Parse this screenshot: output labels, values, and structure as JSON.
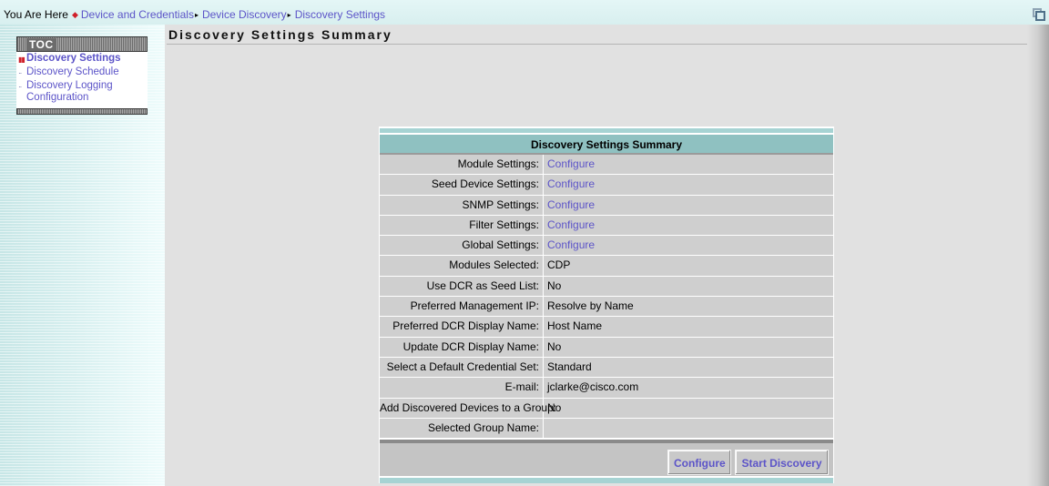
{
  "breadcrumb": {
    "prefix": "You Are Here",
    "items": [
      {
        "label": "Device and Credentials"
      },
      {
        "label": "Device Discovery"
      },
      {
        "label": "Discovery Settings"
      }
    ]
  },
  "page": {
    "title": "Discovery Settings Summary"
  },
  "toc": {
    "header": "TOC",
    "items": [
      {
        "label": "Discovery Settings",
        "active": true
      },
      {
        "label": "Discovery Schedule",
        "active": false
      },
      {
        "label": "Discovery Logging Configuration",
        "active": false
      }
    ]
  },
  "summary": {
    "title": "Discovery Settings Summary",
    "rows": [
      {
        "label": "Module Settings:",
        "value": "Configure",
        "link": true
      },
      {
        "label": "Seed Device Settings:",
        "value": "Configure",
        "link": true
      },
      {
        "label": "SNMP Settings:",
        "value": "Configure",
        "link": true
      },
      {
        "label": "Filter Settings:",
        "value": "Configure",
        "link": true
      },
      {
        "label": "Global Settings:",
        "value": "Configure",
        "link": true
      },
      {
        "label": "Modules Selected:",
        "value": "CDP",
        "link": false
      },
      {
        "label": "Use DCR as Seed List:",
        "value": "No",
        "link": false
      },
      {
        "label": "Preferred Management IP:",
        "value": "Resolve by Name",
        "link": false
      },
      {
        "label": "Preferred DCR Display Name:",
        "value": "Host Name",
        "link": false
      },
      {
        "label": "Update DCR Display Name:",
        "value": "No",
        "link": false
      },
      {
        "label": "Select a Default Credential Set:",
        "value": "Standard",
        "link": false
      },
      {
        "label": "E-mail:",
        "value": "jclarke@cisco.com",
        "link": false
      },
      {
        "label": "Add Discovered Devices to a Group:",
        "value": "No",
        "link": false
      },
      {
        "label": "Selected Group Name:",
        "value": "",
        "link": false
      }
    ],
    "buttons": {
      "configure": "Configure",
      "start": "Start Discovery"
    }
  },
  "colors": {
    "link": "#5c54c8",
    "header_teal": "#8fc1c1",
    "active_bullet": "#d0202a"
  }
}
